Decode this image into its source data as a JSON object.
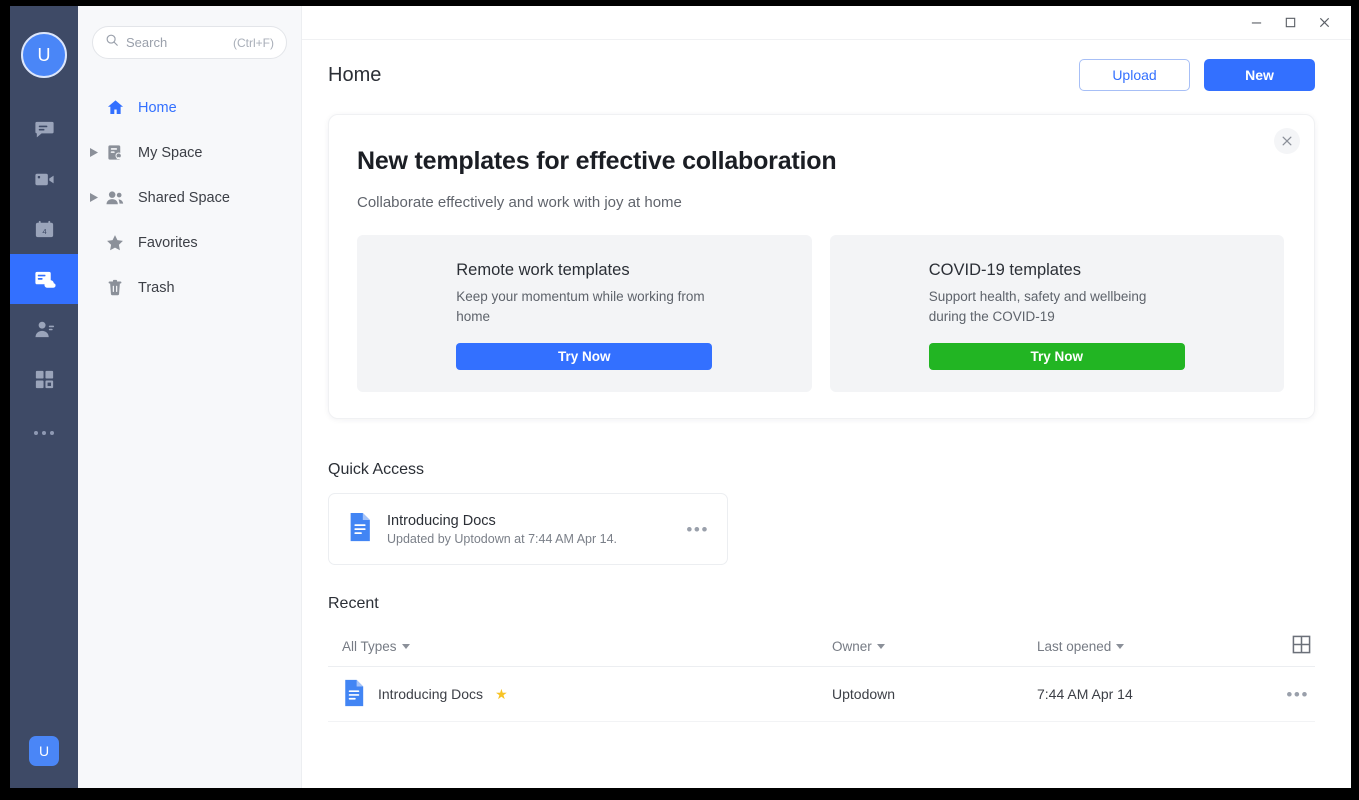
{
  "window": {
    "controls": [
      {
        "name": "minimize",
        "glyph": "minimize-icon"
      },
      {
        "name": "maximize",
        "glyph": "maximize-icon"
      },
      {
        "name": "close",
        "glyph": "close-icon"
      }
    ]
  },
  "rail": {
    "avatar_initial": "U",
    "bottom_badge_initial": "U",
    "items": [
      {
        "icon": "chat-bubble-icon",
        "active": false
      },
      {
        "icon": "video-camera-icon",
        "active": false
      },
      {
        "icon": "calendar-icon",
        "active": false,
        "day": "4"
      },
      {
        "icon": "docs-cloud-icon",
        "active": true
      },
      {
        "icon": "contacts-person-icon",
        "active": false
      },
      {
        "icon": "apps-grid-icon",
        "active": false
      }
    ],
    "more_label": "more-options"
  },
  "search": {
    "placeholder": "Search",
    "shortcut": "(Ctrl+F)",
    "icon": "search-icon"
  },
  "sidebar": {
    "items": [
      {
        "label": "Home",
        "icon": "home-icon",
        "expandable": false,
        "active": true
      },
      {
        "label": "My Space",
        "icon": "my-space-icon",
        "expandable": true,
        "active": false
      },
      {
        "label": "Shared Space",
        "icon": "shared-space-icon",
        "expandable": true,
        "active": false
      },
      {
        "label": "Favorites",
        "icon": "star-icon",
        "expandable": false,
        "active": false
      },
      {
        "label": "Trash",
        "icon": "trash-icon",
        "expandable": false,
        "active": false
      }
    ]
  },
  "header": {
    "title": "Home",
    "upload_label": "Upload",
    "new_label": "New"
  },
  "promo": {
    "title": "New templates for effective collaboration",
    "subtitle": "Collaborate effectively and work with joy at home",
    "close_icon": "close-icon",
    "tiles": [
      {
        "title": "Remote work templates",
        "desc": "Keep your momentum while working from home",
        "button": "Try Now",
        "color": "#3370ff"
      },
      {
        "title": "COVID-19 templates",
        "desc": "Support health, safety and wellbeing during the COVID-19",
        "button": "Try Now",
        "color": "#22b523"
      }
    ]
  },
  "quick_access": {
    "title": "Quick Access",
    "items": [
      {
        "name": "Introducing Docs",
        "meta": "Updated by Uptodown at 7:44 AM Apr 14.",
        "icon": "doc-file-icon",
        "more": "•••"
      }
    ]
  },
  "recent": {
    "title": "Recent",
    "columns": {
      "type_filter": "All Types",
      "owner": "Owner",
      "last_opened": "Last opened",
      "view_toggle": "grid-view-icon"
    },
    "rows": [
      {
        "name": "Introducing Docs",
        "starred": true,
        "star_glyph": "★",
        "owner": "Uptodown",
        "last_opened": "7:44 AM Apr 14",
        "icon": "doc-file-icon",
        "more": "•••"
      }
    ]
  },
  "colors": {
    "accent_blue": "#3370ff",
    "accent_green": "#22b523",
    "rail_bg": "#3e4a66",
    "sidebar_bg": "#f7f8fa",
    "star_gold": "#f7c325"
  }
}
